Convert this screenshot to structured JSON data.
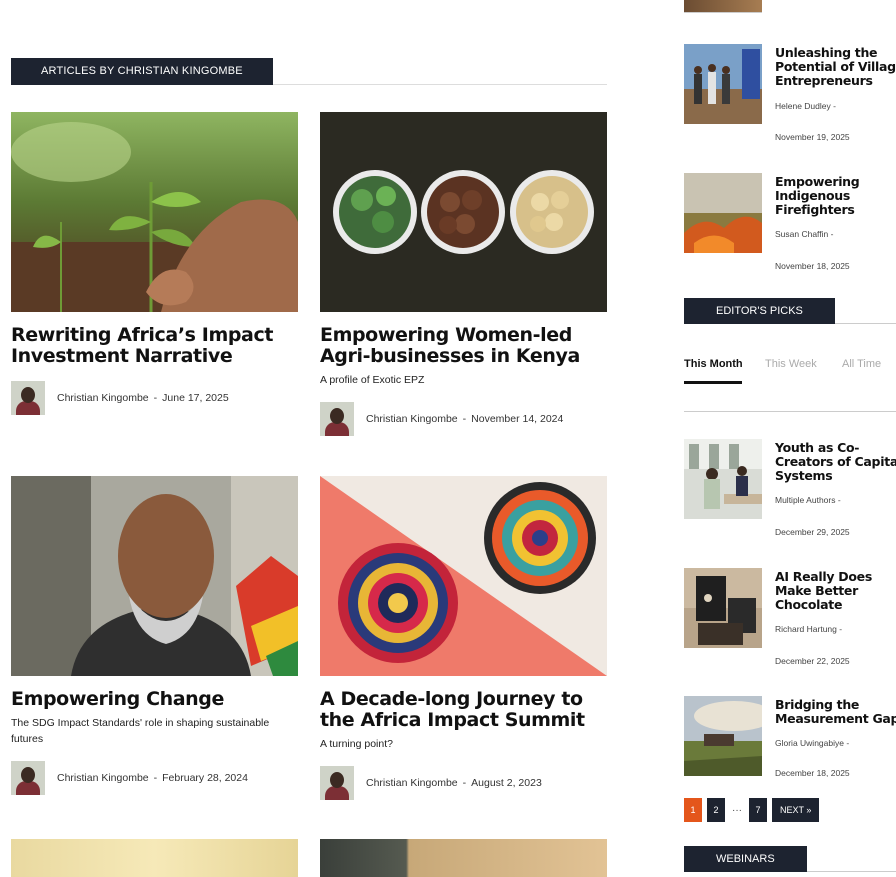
{
  "section_title": "ARTICLES BY CHRISTIAN KINGOMBE",
  "articles": [
    {
      "title": "Rewriting Africa’s Impact Investment Narrative",
      "subtitle": "",
      "author": "Christian Kingombe",
      "date": "June 17, 2025"
    },
    {
      "title": "Empowering Women-led Agri-businesses in Kenya",
      "subtitle": "A profile of Exotic EPZ",
      "author": "Christian Kingombe",
      "date": "November 14, 2024"
    },
    {
      "title": "Empowering Change",
      "subtitle": "The SDG Impact Standards' role in shaping sustainable futures",
      "author": "Christian Kingombe",
      "date": "February 28, 2024"
    },
    {
      "title": "A Decade-long Journey to the Africa Impact Summit",
      "subtitle": "A turning point?",
      "author": "Christian Kingombe",
      "date": "August 2, 2023"
    }
  ],
  "meta_separator": "-",
  "sidebar_top": [
    {
      "title": "Unleashing the Potential of Village Entrepreneurs",
      "author": "Helene Dudley",
      "date": "November 19, 2025"
    },
    {
      "title": "Empowering Indigenous Firefighters",
      "author": "Susan Chaffin",
      "date": "November 18, 2025"
    }
  ],
  "editors_picks": {
    "label": "EDITOR'S PICKS",
    "tabs": [
      "This Month",
      "This Week",
      "All Time"
    ],
    "items": [
      {
        "title": "Youth as Co-Creators of Capital Systems",
        "author": "Multiple Authors",
        "date": "December 29, 2025"
      },
      {
        "title": "AI Really Does Make Better Chocolate",
        "author": "Richard Hartung",
        "date": "December 22, 2025"
      },
      {
        "title": "Bridging the Measurement Gap",
        "author": "Gloria Uwingabiye",
        "date": "December 18, 2025"
      }
    ]
  },
  "pager": {
    "p1": "1",
    "p2": "2",
    "dots": "···",
    "p7": "7",
    "next": "NEXT »"
  },
  "webinars_label": "WEBINARS",
  "colors": {
    "dark": "#1d2330",
    "accent": "#e4561b"
  }
}
